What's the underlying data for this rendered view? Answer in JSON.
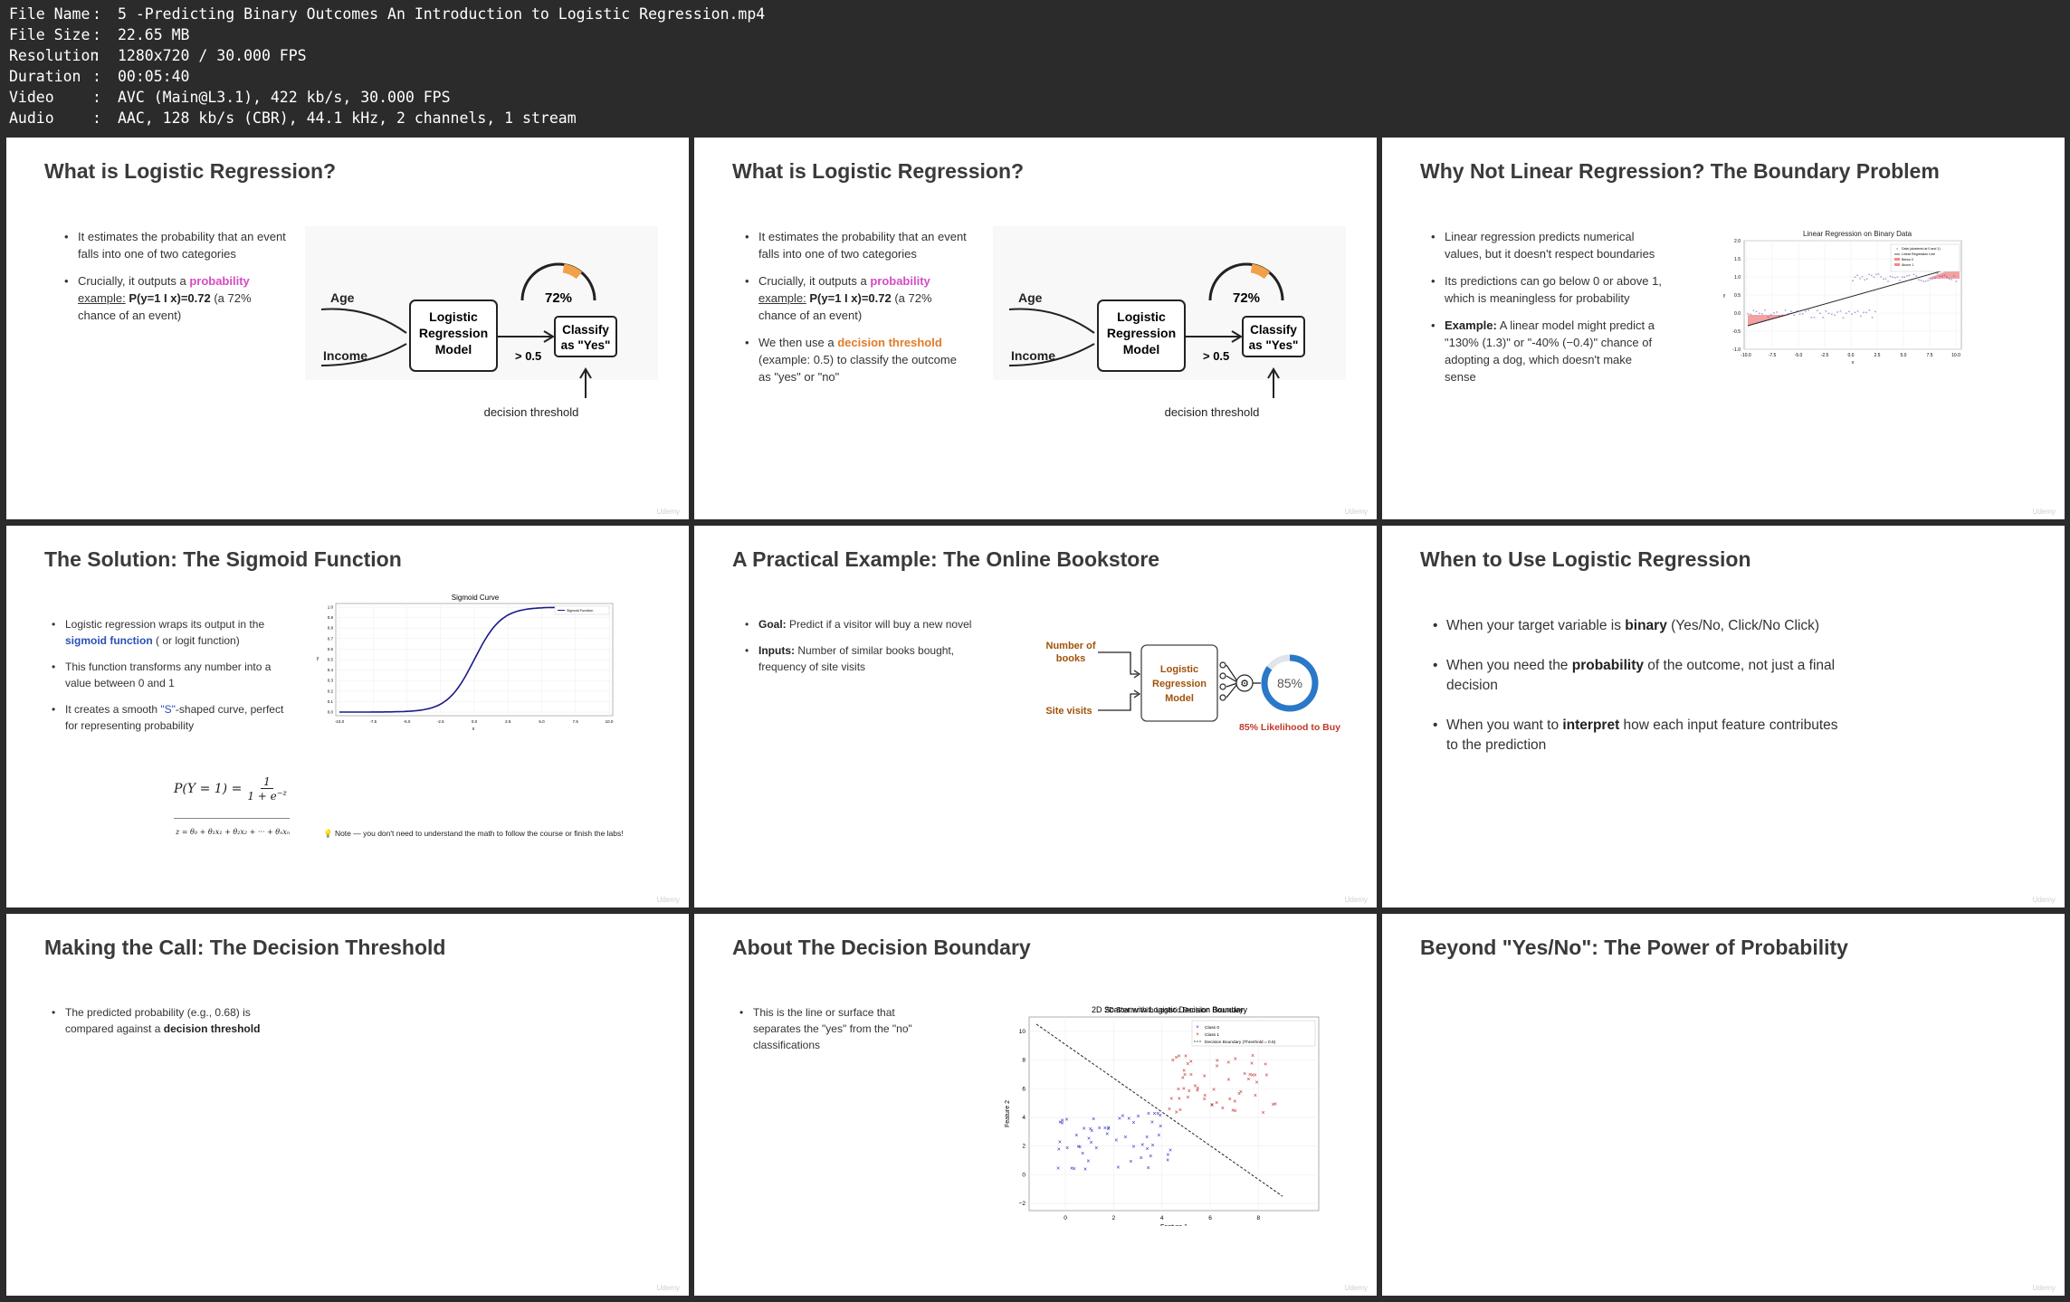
{
  "meta": {
    "rows": [
      {
        "key": "File Name",
        "value": "5 -Predicting Binary Outcomes An Introduction to Logistic Regression.mp4"
      },
      {
        "key": "File Size",
        "value": "22.65 MB"
      },
      {
        "key": "Resolution",
        "value": "1280x720 / 30.000 FPS"
      },
      {
        "key": "Duration",
        "value": "00:05:40"
      },
      {
        "key": "Video",
        "value": "AVC (Main@L3.1), 422 kb/s, 30.000 FPS"
      },
      {
        "key": "Audio",
        "value": "AAC, 128 kb/s (CBR), 44.1 kHz, 2 channels, 1 stream"
      }
    ]
  },
  "watermark": "Udemy",
  "slides": [
    {
      "title": "What is Logistic Regression?",
      "b1": "It estimates the probability that an event falls into one of two categories",
      "b2_pre": "Crucially, it outputs a ",
      "b2_hl": "probability",
      "b2_ex": "example:",
      "b2_formula": "P(y=1 I x)=0.72",
      "b2_post": " (a 72% chance of an event)",
      "diagram": {
        "in1": "Age",
        "in2": "Income",
        "model": [
          "Logistic",
          "Regression",
          "Model"
        ],
        "gauge": "72%",
        "gauge_level": 0.72,
        "threshold": "> 0.5",
        "out": [
          "Classify",
          "as \"Yes\""
        ],
        "caption": "decision threshold"
      }
    },
    {
      "title": "What is Logistic Regression?",
      "b1": "It estimates the probability that an event falls into one of two categories",
      "b2_pre": "Crucially, it outputs a ",
      "b2_hl": "probability",
      "b2_ex": "example:",
      "b2_formula": "P(y=1 I x)=0.72",
      "b2_post": " (a 72% chance of an event)",
      "b3_pre": "We then use a ",
      "b3_hl": "decision threshold",
      "b3_post": " (example: 0.5) to classify the outcome as \"yes\" or \"no\"",
      "diagram": {
        "in1": "Age",
        "in2": "Income",
        "model": [
          "Logistic",
          "Regression",
          "Model"
        ],
        "gauge": "72%",
        "gauge_level": 0.72,
        "threshold": "> 0.5",
        "out": [
          "Classify",
          "as \"Yes\""
        ],
        "caption": "decision threshold"
      }
    },
    {
      "title": "Why Not Linear Regression?  The Boundary Problem",
      "b1": "Linear regression predicts numerical values, but it doesn't respect boundaries",
      "b2": "Its predictions can go below 0 or above 1, which is meaningless for probability",
      "b3_lead": "Example:",
      "b3": " A linear model might predict a \"130% (1.3)\" or \"-40% (−0.4)\" chance of adopting a dog, which doesn't make sense",
      "chart": {
        "title": "Linear Regression on Binary Data",
        "legend": [
          "Data (clustered at 0 and 1)",
          "Linear Regression Line",
          "Below 0",
          "Above 1"
        ],
        "yticks": [
          "2.0",
          "1.5",
          "1.0",
          "0.5",
          "0.0",
          "-0.5",
          "-1.0"
        ],
        "xticks": [
          "-10.0",
          "-7.5",
          "-5.0",
          "-2.5",
          "0.0",
          "2.5",
          "5.0",
          "7.5",
          "10.0"
        ],
        "xlabel": "x",
        "ylabel": "y"
      }
    },
    {
      "title": "The Solution: The Sigmoid Function",
      "b1_pre": "Logistic regression wraps its output in the ",
      "b1_hl": "sigmoid function",
      "b1_post": " ( or logit function)",
      "b2": "This function transforms any number into a value between 0 and 1",
      "b3_pre": "It creates a smooth ",
      "b3_hl": "\"S\"",
      "b3_post": "-shaped curve, perfect for representing probability",
      "formula1_lhs": "P(Y = 1) =",
      "formula1_num": "1",
      "formula1_den": "1 + e",
      "formula1_exp": "−z",
      "formula2": "z = θ₀ + θ₁x₁ + θ₂x₂ + ··· + θₙxₙ",
      "note": "💡 Note — you don't need to understand the math to follow the course or finish the labs!",
      "chart": {
        "title": "Sigmoid Curve",
        "legend": "Sigmoid Function",
        "yticks": [
          "1.0",
          "0.9",
          "0.8",
          "0.7",
          "0.6",
          "0.5",
          "0.4",
          "0.3",
          "0.2",
          "0.1",
          "0.0"
        ],
        "xticks": [
          "-10.0",
          "-7.5",
          "-5.0",
          "-2.5",
          "0.0",
          "2.5",
          "5.0",
          "7.5",
          "10.0"
        ],
        "xlabel": "x",
        "ylabel": "y"
      }
    },
    {
      "title": "A Practical Example: The Online Bookstore",
      "b1_lead": "Goal:",
      "b1": " Predict if a visitor will buy a new novel",
      "b2_lead": "Inputs:",
      "b2": " Number of similar books bought, frequency of site visits",
      "diagram": {
        "in1": [
          "Number of",
          "books"
        ],
        "in2": "Site visits",
        "model": [
          "Logistic",
          "Regression",
          "Model"
        ],
        "ring": "85%",
        "ring_level": 0.85,
        "caption": "85% Likelihood to Buy"
      }
    },
    {
      "title": "When to Use Logistic Regression",
      "b1_pre": "When your target variable is ",
      "b1_hl": "binary",
      "b1_post": " (Yes/No, Click/No Click)",
      "b2_pre": "When you need the ",
      "b2_hl": "probability",
      "b2_post": " of the outcome, not just a final decision",
      "b3_pre": "When you want to ",
      "b3_hl": "interpret",
      "b3_post": " how each input feature contributes to the prediction"
    },
    {
      "title": "Making the Call: The Decision Threshold",
      "b1_pre": "The predicted probability (e.g., 0.68) is compared against a ",
      "b1_hl": "decision threshold"
    },
    {
      "title": "About The Decision Boundary",
      "b1": "This is the line or surface that separates the \"yes\" from the \"no\" classifications",
      "chart": {
        "title": "2D Scatter with Logistic Decision Boundary",
        "legend": [
          "Class 0",
          "Class 1",
          "Decision Boundary (Threshold = 0.5)"
        ],
        "yticks": [
          "10",
          "8",
          "6",
          "4",
          "2",
          "0",
          "−2"
        ],
        "xticks": [
          "0",
          "2",
          "4",
          "6",
          "8"
        ],
        "xlabel": "Feature 1",
        "ylabel": "Feature 2"
      }
    },
    {
      "title": "Beyond \"Yes/No\": The Power of Probability"
    }
  ]
}
